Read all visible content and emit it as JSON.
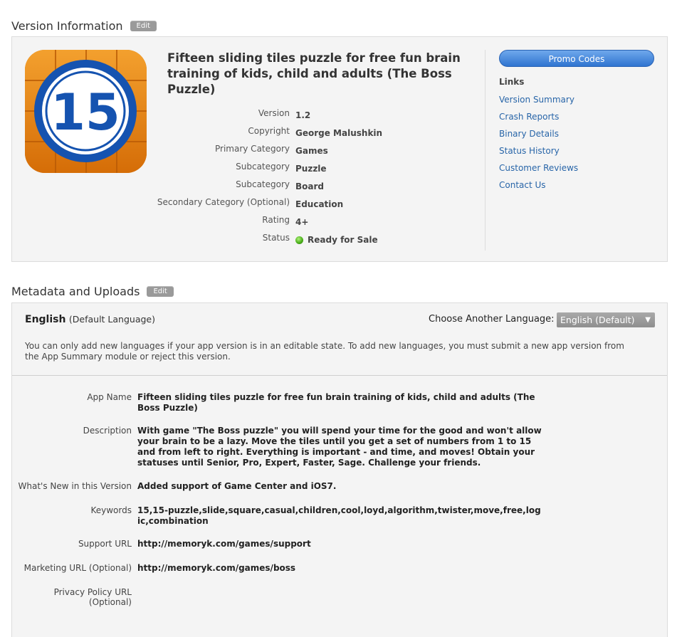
{
  "version_section": {
    "title": "Version Information",
    "edit_label": "Edit",
    "app_title": "Fifteen sliding tiles puzzle for free fun brain training of kids, child and adults (The Boss Puzzle)",
    "icon_number": "15",
    "rows": [
      {
        "label": "Version",
        "value": "1.2"
      },
      {
        "label": "Copyright",
        "value": "George Malushkin"
      },
      {
        "label": "Primary Category",
        "value": "Games"
      },
      {
        "label": "Subcategory",
        "value": "Puzzle"
      },
      {
        "label": "Subcategory",
        "value": "Board"
      },
      {
        "label": "Secondary Category (Optional)",
        "value": "Education"
      },
      {
        "label": "Rating",
        "value": "4+"
      },
      {
        "label": "Status",
        "value": "Ready for Sale"
      }
    ],
    "status_color": "#4caf1c",
    "promo_label": "Promo Codes",
    "links_title": "Links",
    "links": [
      "Version Summary",
      "Crash Reports",
      "Binary Details",
      "Status History",
      "Customer Reviews",
      "Contact Us"
    ]
  },
  "metadata_section": {
    "title": "Metadata and Uploads",
    "edit_label": "Edit",
    "language": "English",
    "language_note": "(Default Language)",
    "choose_label": "Choose Another Language:",
    "selected_language": "English (Default)",
    "note": "You can only add new languages if your app version is in an editable state. To add new languages, you must submit a new app version from the App Summary module or reject this version.",
    "rows": [
      {
        "label": "App Name",
        "value": "Fifteen sliding tiles puzzle for free fun brain training of kids, child and adults (The Boss Puzzle)"
      },
      {
        "label": "Description",
        "value": "With game \"The Boss puzzle\" you will spend your time for the good and won't allow your brain to be a lazy. Move the tiles until you get a set of numbers from 1 to 15 and from left to right. Everything is important - and time, and moves! Obtain your statuses until Senior, Pro, Expert, Faster, Sage. Challenge your friends."
      },
      {
        "label": "What's New in this Version",
        "value": "Added support of Game Center and iOS7."
      },
      {
        "label": "Keywords",
        "value": "15,15-puzzle,slide,square,casual,children,cool,loyd,algorithm,twister,move,free,logic,combination"
      },
      {
        "label": "Support URL",
        "value": "http://memoryk.com/games/support"
      },
      {
        "label": "Marketing URL (Optional)",
        "value": "http://memoryk.com/games/boss"
      },
      {
        "label": "Privacy Policy URL (Optional)",
        "value": ""
      }
    ]
  }
}
